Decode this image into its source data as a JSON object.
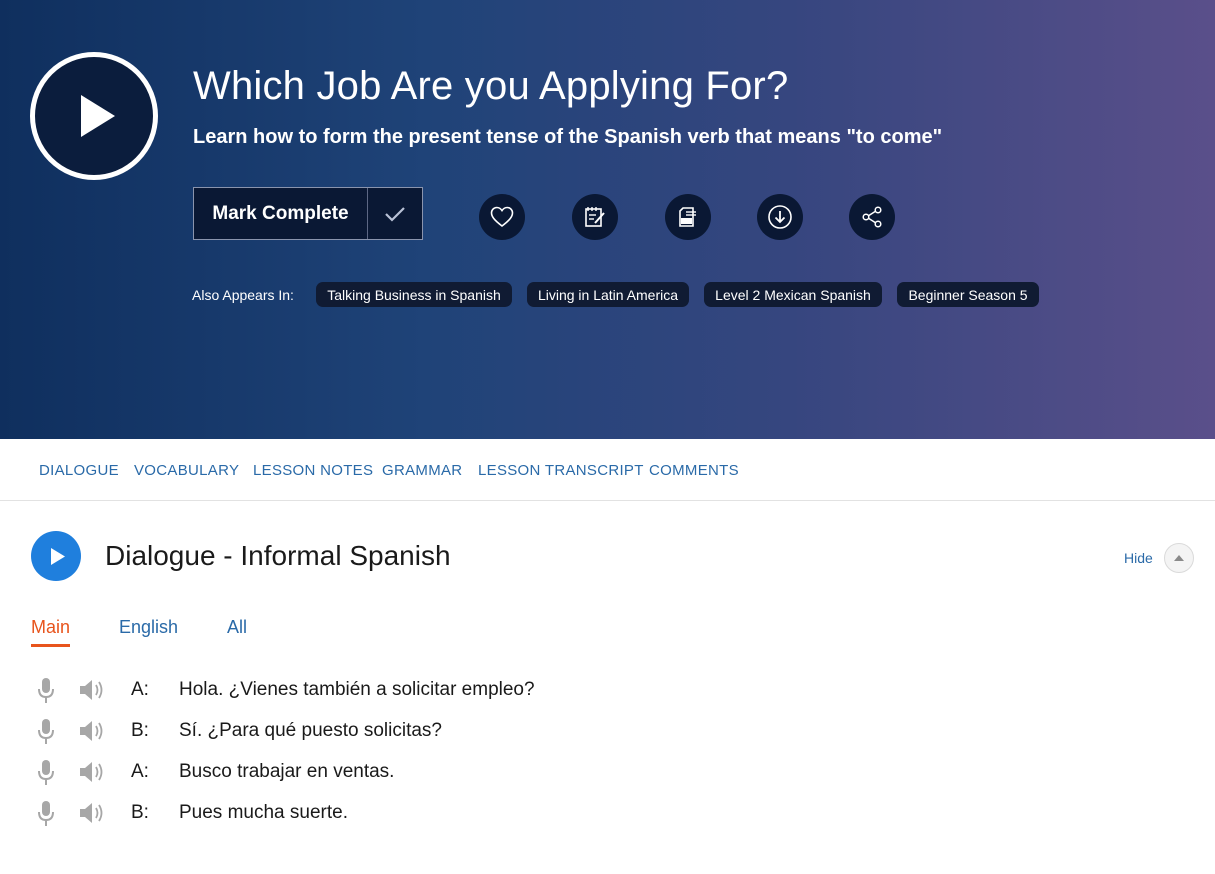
{
  "lesson": {
    "title": "Which Job Are you Applying For?",
    "subtitle": "Learn how to form the present tense of the Spanish verb that means \"to come\"",
    "mark_complete_label": "Mark Complete"
  },
  "actions": [
    {
      "icon": "heart-icon"
    },
    {
      "icon": "notes-icon"
    },
    {
      "icon": "pdf-icon"
    },
    {
      "icon": "download-icon"
    },
    {
      "icon": "share-icon"
    }
  ],
  "also_appears": {
    "label": "Also Appears In:",
    "chips": [
      "Talking Business in Spanish",
      "Living in Latin America",
      "Level 2 Mexican Spanish",
      "Beginner Season 5"
    ]
  },
  "tabs": [
    "DIALOGUE",
    "VOCABULARY",
    "LESSON NOTES",
    "GRAMMAR",
    "LESSON TRANSCRIPT",
    "COMMENTS"
  ],
  "dialogue": {
    "title": "Dialogue - Informal Spanish",
    "hide_label": "Hide",
    "subtabs": [
      "Main",
      "English",
      "All"
    ],
    "active_subtab": "Main",
    "lines": [
      {
        "speaker": "A:",
        "text": "Hola. ¿Vienes también a solicitar empleo?"
      },
      {
        "speaker": "B:",
        "text": "Sí. ¿Para qué puesto solicitas?"
      },
      {
        "speaker": "A:",
        "text": "Busco trabajar en ventas."
      },
      {
        "speaker": "B:",
        "text": "Pues mucha suerte."
      }
    ]
  },
  "colors": {
    "accent_blue": "#1f7fdd",
    "link_blue": "#2a6aa8",
    "active_orange": "#e8541c"
  }
}
